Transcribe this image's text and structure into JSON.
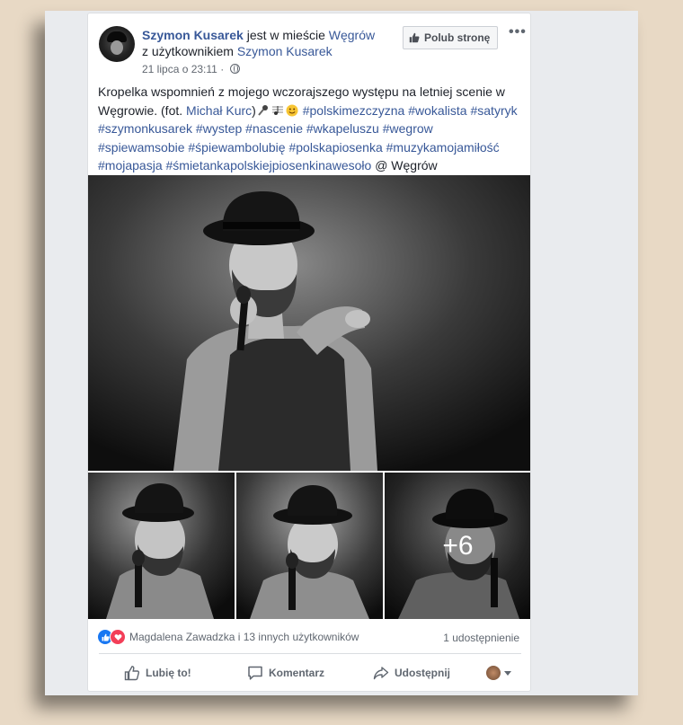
{
  "post": {
    "author": "Szymon Kusarek",
    "in_city_text": "jest w mieście",
    "city": "Węgrów",
    "with_text": "z użytkownikiem",
    "with_user": "Szymon Kusarek",
    "date": "21 lipca o 23:11",
    "dot": "·",
    "like_page_label": "Polub stronę",
    "more_label": "•••",
    "text_part1": "Kropelka wspomnień z mojego wczorajszego występu na letniej scenie w Węgrowie. (fot. ",
    "photographer": "Michał Kurc",
    "text_part2": ")",
    "hashtags": "#polskimezczyzna #wokalista #satyryk #szymonkusarek #wystep #nascenie #wkapeluszu #wegrow #spiewamsobie #śpiewambolubię #polskapiosenka #muzykamojamiłość #mojapasja #śmietankapolskiejpiosenkinawesoło",
    "location_suffix": "@ Węgrów",
    "more_photos": "+6"
  },
  "footer": {
    "reactions_text": "Magdalena Zawadzka i 13 innych użytkowników",
    "shares_text": "1 udostępnienie",
    "like_label": "Lubię to!",
    "comment_label": "Komentarz",
    "share_label": "Udostępnij"
  },
  "colors": {
    "link": "#385898",
    "like_blue": "#1877f2",
    "love_red": "#f33e58",
    "background": "#e8d9c5"
  },
  "icons": {
    "page_like": "thumbs-up-icon",
    "globe": "globe-icon",
    "like_reaction": "like-reaction-icon",
    "love_reaction": "love-reaction-icon",
    "like_action": "thumbs-up-outline-icon",
    "comment_action": "comment-bubble-icon",
    "share_action": "share-arrow-icon"
  }
}
